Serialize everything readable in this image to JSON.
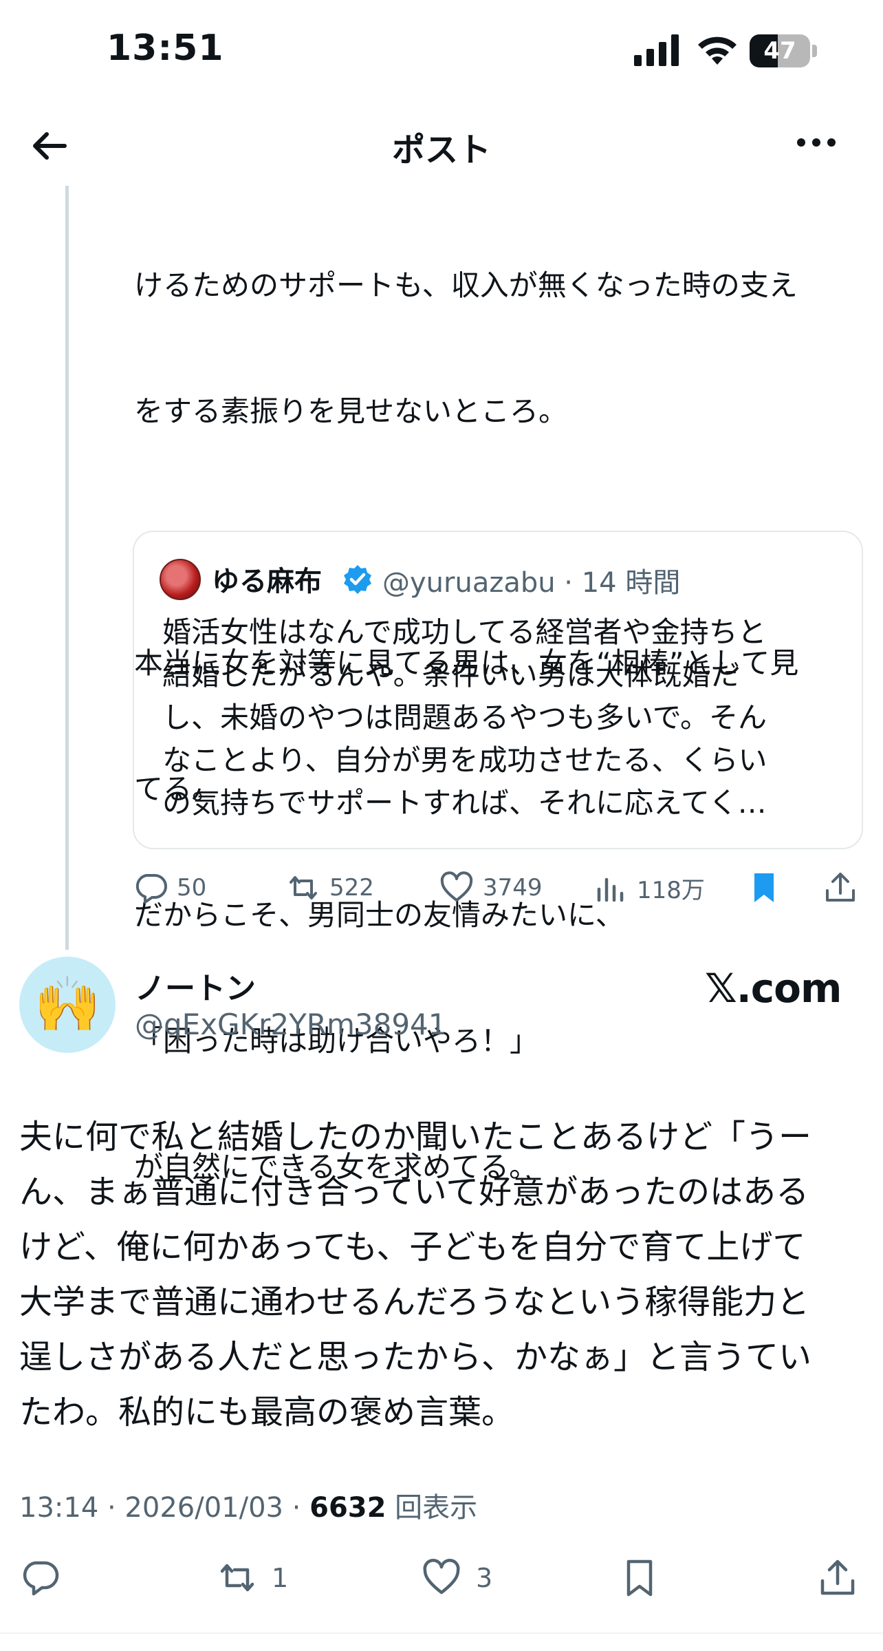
{
  "status_bar": {
    "time": "13:51",
    "battery_level": "47",
    "battery_fraction": 0.47
  },
  "header": {
    "title": "ポスト"
  },
  "parent_post": {
    "text_lines": [
      "けるためのサポートも、収入が無くなった時の支え",
      "をする素振りを見せないところ。",
      "",
      "本当に女を対等に見てる男は、女を“相棒”として見",
      "てる。",
      "だからこそ、男同士の友情みたいに、",
      "「困った時は助け合いやろ！」",
      "が自然にできる女を求めてる。"
    ],
    "quote": {
      "name": "ゆる麻布",
      "handle_time": "@yuruazabu · 14 時間",
      "text_lines": [
        "婚活女性はなんで成功してる経営者や金持ちと",
        "結婚したがるんや。条件いい男は大体既婚だ",
        "し、未婚のやつは問題あるやつも多いで。そん",
        "なことより、自分が男を成功させたる、くらい",
        "の気持ちでサポートすれば、それに応えてく…"
      ]
    },
    "actions": {
      "replies": "50",
      "reposts": "522",
      "likes": "3749",
      "views": "118万"
    }
  },
  "main_post": {
    "name": "ノートン",
    "handle": "@qExGKr2YRm38941",
    "source_badge": "𝕏.com",
    "avatar_emoji": "🙌",
    "text_lines": [
      "夫に何で私と結婚したのか聞いたことあるけど「うー",
      "ん、まぁ普通に付き合っていて好意があったのはある",
      "けど、俺に何かあっても、子どもを自分で育て上げて",
      "大学まで普通に通わせるんだろうなという稼得能力と",
      "逞しさがある人だと思ったから、かなぁ」と言うてい",
      "たわ。私的にも最高の褒め言葉。"
    ],
    "timestamp": "13:14 · 2026/01/03 · ",
    "views_count": "6632",
    "views_label": " 回表示",
    "actions": {
      "reposts": "1",
      "likes": "3"
    }
  },
  "colors": {
    "accent": "#1d9bf0",
    "text_primary": "#0f1419",
    "text_secondary": "#536471",
    "border": "#e4e8eb",
    "thread_line": "#cfd9de"
  }
}
